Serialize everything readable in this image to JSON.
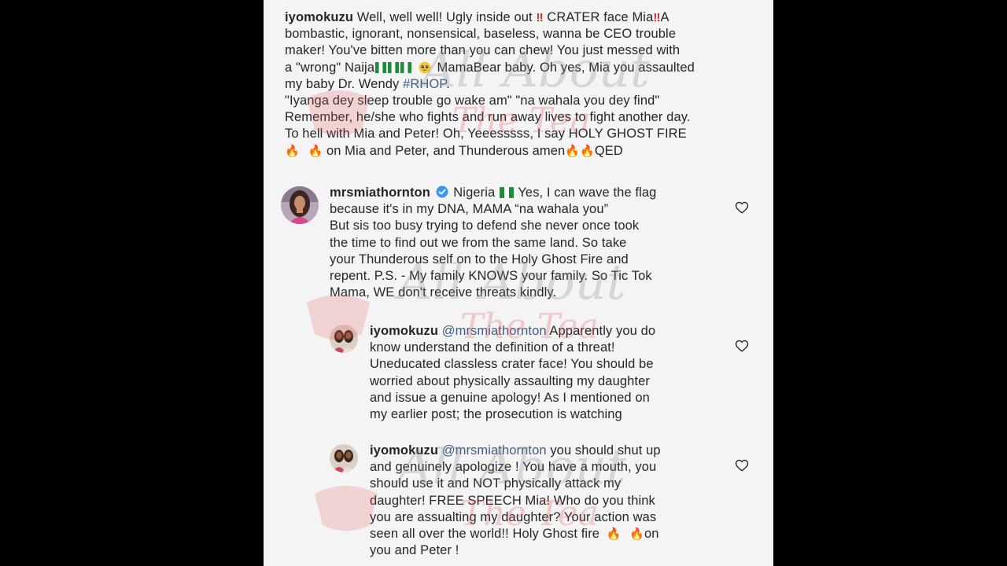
{
  "top_comment": {
    "username": "iyomokuzu",
    "line1": "Well, well well! Ugly inside out",
    "line1b": "CRATER face Mia",
    "line1c": "A",
    "line2": "bombastic, ignorant, nonsensical, baseless, wanna be CEO trouble",
    "line3": "maker! You've bitten more than you can chew!  You just messed with",
    "line4a": "a \"wrong\" Naija",
    "line4b": "MamaBear baby. Oh yes, Mia you assaulted",
    "line5a": "my baby  Dr. Wendy",
    "line5_tag": "#RHOP",
    "line5b": ".",
    "line6": "\"Iyanga dey sleep trouble go wake am\" \"na wahala you dey find\"",
    "line7": "Remember, he/she who fights  and run away lives to fight another day.",
    "line8": "To hell with Mia and Peter!  Oh, Yeeesssss, I  say HOLY GHOST  FIRE",
    "line9a": "on Mia and Peter, and  Thunderous amen",
    "line9b": "QED"
  },
  "comment1": {
    "username": "mrsmiathornton",
    "lines": [
      "Nigeria",
      "Yes, I can wave the flag",
      "because it's in my DNA,  MAMA “na wahala you”",
      "But sis too busy trying to defend she never once took",
      "the time to find out we from the same land.  So take",
      "your Thunderous self on to the Holy Ghost Fire and",
      "repent.  P.S. - My family KNOWS your family.  So Tic Tok",
      "Mama, WE don't receive threats kindly."
    ]
  },
  "reply1": {
    "username": "iyomokuzu",
    "mention": "@mrsmiathornton",
    "lines": [
      "Apparently you do",
      "know understand the definition of  a threat!",
      "Uneducated classless crater face! You should be",
      "worried about physically assaulting my daughter",
      "and issue a genuine apology!  As I  mentioned on",
      "my earlier post; the prosecution is watching"
    ]
  },
  "reply2": {
    "username": "iyomokuzu",
    "mention": "@mrsmiathornton",
    "lines": [
      "you should shut up",
      "and genuinely apologize !  You have a mouth,  you",
      "should use it and NOT physically attack my",
      "daughter! FREE SPEECH Mia!  Who do you think",
      "you are assualting my daughter? Your action was",
      "seen all over the world!! Holy Ghost fire",
      "on",
      "you and Peter !"
    ]
  },
  "watermark": {
    "line1": "All About",
    "line2": "The Tea"
  },
  "colors": {
    "text": "#262626",
    "link": "#3b5d8a",
    "verified": "#3897f0",
    "watermark": "#e85a5a"
  },
  "icons": [
    "heart-icon",
    "verified-badge-icon",
    "fire-emoji",
    "double-exclamation-emoji",
    "nigeria-flag-emoji",
    "pleading-face-emoji"
  ]
}
